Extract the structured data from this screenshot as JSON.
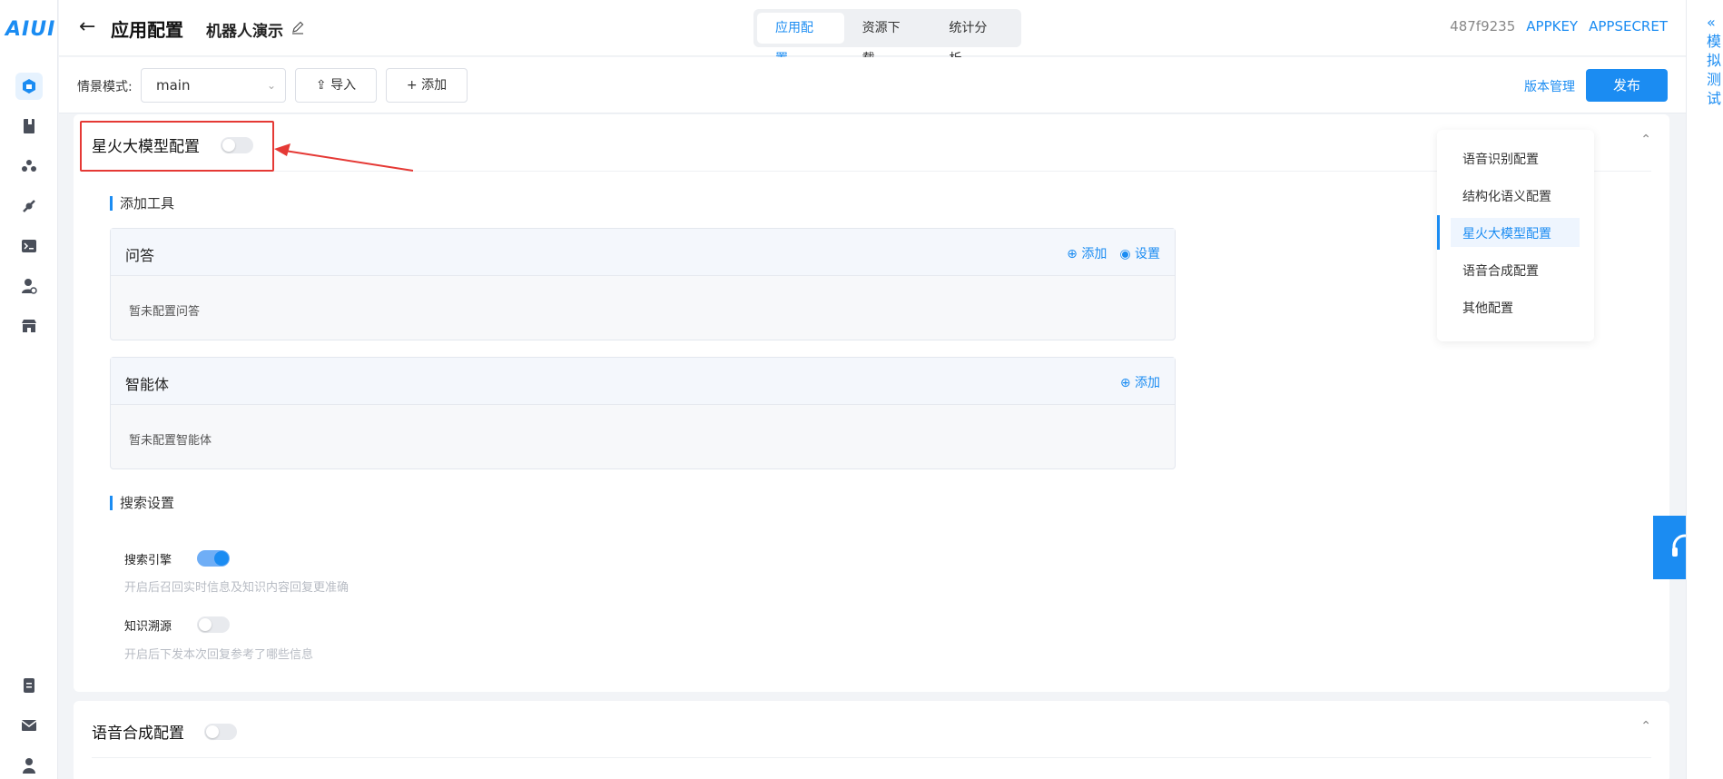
{
  "logo": "AIUI",
  "header": {
    "title": "应用配置",
    "robot_name": "机器人演示",
    "tabs": [
      "应用配置",
      "资源下载",
      "统计分析"
    ],
    "app_id": "487f9235",
    "appkey": "APPKEY",
    "appsecret": "APPSECRET"
  },
  "toolbar": {
    "scene_label": "情景模式:",
    "scene_value": "main",
    "import_label": "导入",
    "add_label": "添加",
    "version_label": "版本管理",
    "publish_label": "发布"
  },
  "llm_section": {
    "title": "星火大模型配置",
    "enabled": false,
    "add_tools_heading": "添加工具",
    "qa_panel": {
      "title": "问答",
      "add_label": "添加",
      "settings_label": "设置",
      "empty_text": "暂未配置问答"
    },
    "agent_panel": {
      "title": "智能体",
      "add_label": "添加",
      "empty_text": "暂未配置智能体"
    },
    "search_heading": "搜索设置",
    "search_engine": {
      "label": "搜索引擎",
      "enabled": true,
      "desc": "开启后召回实时信息及知识内容回复更准确"
    },
    "knowledge_trace": {
      "label": "知识溯源",
      "enabled": false,
      "desc": "开启后下发本次回复参考了哪些信息"
    }
  },
  "tts_section": {
    "title": "语音合成配置",
    "enabled": false
  },
  "anchor_nav": {
    "items": [
      "语音识别配置",
      "结构化语义配置",
      "星火大模型配置",
      "语音合成配置",
      "其他配置"
    ],
    "active": "星火大模型配置"
  },
  "right_rail": {
    "collapse": "«",
    "label": [
      "模",
      "拟",
      "测",
      "试"
    ]
  },
  "colors": {
    "accent": "#1b8cf2",
    "highlight": "#e53935"
  }
}
